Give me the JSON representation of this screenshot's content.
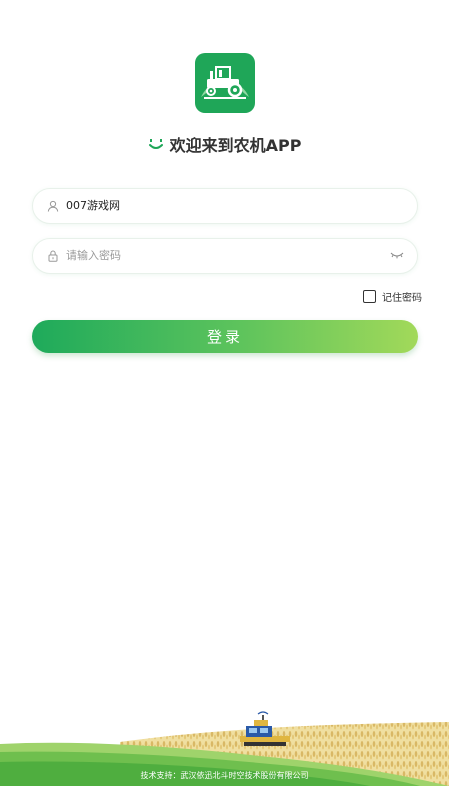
{
  "header": {
    "welcome_text": "欢迎来到农机APP"
  },
  "form": {
    "username_value": "007游戏网",
    "password_placeholder": "请输入密码",
    "remember_label": "记住密码",
    "login_label": "登录"
  },
  "footer": {
    "support_text": "技术支持：武汉依迅北斗时空技术股份有限公司"
  },
  "colors": {
    "brand": "#1fa658",
    "button_start": "#1eaa5b",
    "button_end": "#a2d95a"
  },
  "icons": {
    "logo": "tractor-logo-icon",
    "welcome": "smile-icon",
    "username": "user-icon",
    "password": "lock-icon",
    "visibility": "eye-closed-icon"
  }
}
